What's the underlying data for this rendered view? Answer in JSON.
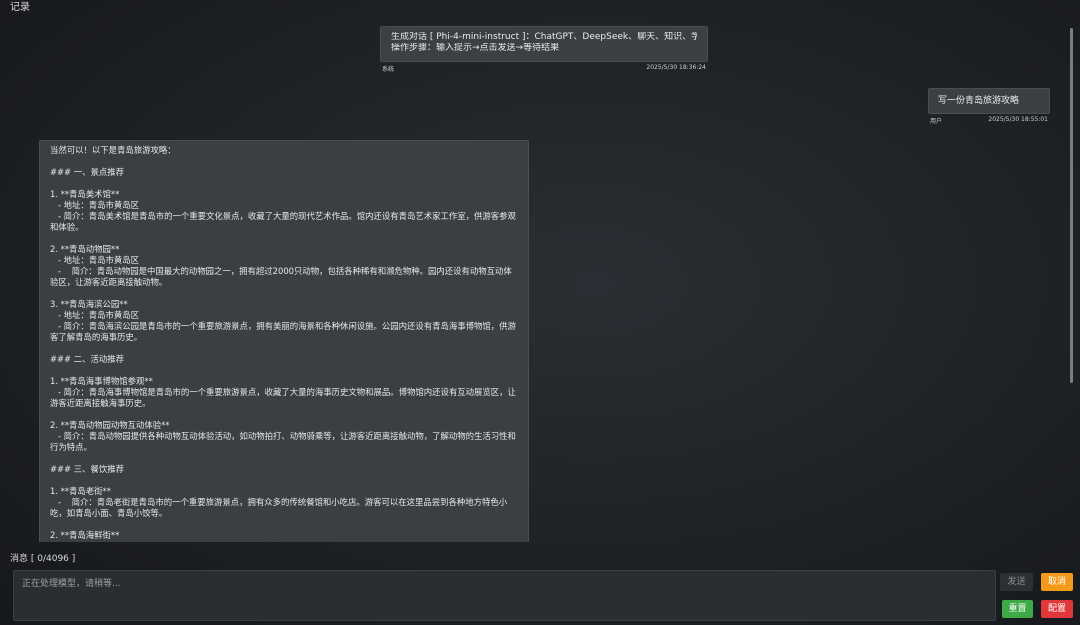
{
  "header": {
    "title": "记录"
  },
  "messages": {
    "system": {
      "line1": "生成对话 [ Phi-4-mini-instruct ]：ChatGPT、DeepSeek、聊天、知识、学习...",
      "line2": "操作步骤：输入提示→点击发送→等待结果",
      "sender": "系统",
      "time": "2025/5/30 18:36:24"
    },
    "user": {
      "text": "写一份青岛旅游攻略",
      "sender": "用户",
      "time": "2025/5/30 18:55:01"
    },
    "assistant": {
      "lines": [
        "当然可以！以下是青岛旅游攻略：",
        "",
        "### 一、景点推荐",
        "",
        "1. **青岛美术馆**",
        "   - 地址：青岛市黄岛区",
        "   - 简介：青岛美术馆是青岛市的一个重要文化景点，收藏了大量的现代艺术作品。馆内还设有青岛艺术家工作室，供游客参观和体验。",
        "",
        "2. **青岛动物园**",
        "   - 地址：青岛市黄岛区",
        "   -    简介：青岛动物园是中国最大的动物园之一，拥有超过2000只动物，包括各种稀有和濒危物种。园内还设有动物互动体验区，让游客近距离接触动物。",
        "",
        "3. **青岛海滨公园**",
        "   - 地址：青岛市黄岛区",
        "   - 简介：青岛海滨公园是青岛市的一个重要旅游景点，拥有美丽的海景和各种休闲设施。公园内还设有青岛海事博物馆，供游客了解青岛的海事历史。",
        "",
        "### 二、活动推荐",
        "",
        "1. **青岛海事博物馆参观**",
        "   - 简介：青岛海事博物馆是青岛市的一个重要旅游景点，收藏了大量的海事历史文物和展品。博物馆内还设有互动展览区，让游客近距离接触海事历史。",
        "",
        "2. **青岛动物园动物互动体验**",
        "   - 简介：青岛动物园提供各种动物互动体验活动，如动物拍打、动物骑乘等，让游客近距离接触动物，了解动物的生活习性和行为特点。",
        "",
        "### 三、餐饮推荐",
        "",
        "1. **青岛老街**",
        "   -    简介：青岛老街是青岛市的一个重要旅游景点，拥有众多的传统餐馆和小吃店。游客可以在这里品尝到各种地方特色小吃，如青岛小面、青岛小饺等。",
        "",
        "2. **青岛海鲜街**"
      ]
    }
  },
  "composer": {
    "counter_label": "消息 [ 0/4096 ]",
    "placeholder": "正在处理模型，请稍等...",
    "send_label": "发送",
    "cancel_label": "取消",
    "reset_label": "重置",
    "config_label": "配置"
  },
  "colors": {
    "cancel": "#f39a1a",
    "reset": "#3daa47",
    "config": "#e0383a"
  }
}
